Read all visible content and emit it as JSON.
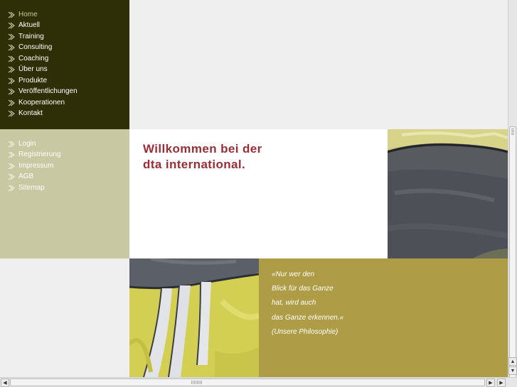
{
  "nav_main": {
    "items": [
      {
        "label": "Home",
        "active": true
      },
      {
        "label": "Aktuell"
      },
      {
        "label": "Training"
      },
      {
        "label": "Consulting"
      },
      {
        "label": "Coaching"
      },
      {
        "label": "Über uns"
      },
      {
        "label": "Produkte"
      },
      {
        "label": "Veröffentlichungen"
      },
      {
        "label": "Kooperationen"
      },
      {
        "label": "Kontakt"
      }
    ]
  },
  "nav_secondary": {
    "items": [
      {
        "label": "Login"
      },
      {
        "label": "Registrierung"
      },
      {
        "label": "Impressum"
      },
      {
        "label": "AGB"
      },
      {
        "label": "Sitemap"
      }
    ]
  },
  "welcome": {
    "line1": "Willkommen bei der",
    "line2": "dta international."
  },
  "quote": {
    "lines": [
      "«Nur wer den",
      "Blick für das Ganze",
      "hat, wird auch",
      "das Ganze erkennen.«",
      "(Unsere Philosophie)"
    ]
  },
  "colors": {
    "nav_main_bg": "#2f2f07",
    "nav_secondary_bg": "#c8c8a3",
    "welcome_text": "#9b2d37",
    "quote_bg": "#ae9d46"
  },
  "icons": {
    "nav_arrow": "double-chevron-right-icon",
    "scroll_up": "arrow-up-icon",
    "scroll_down": "arrow-down-icon",
    "scroll_left": "arrow-left-icon",
    "scroll_right": "arrow-right-icon"
  }
}
